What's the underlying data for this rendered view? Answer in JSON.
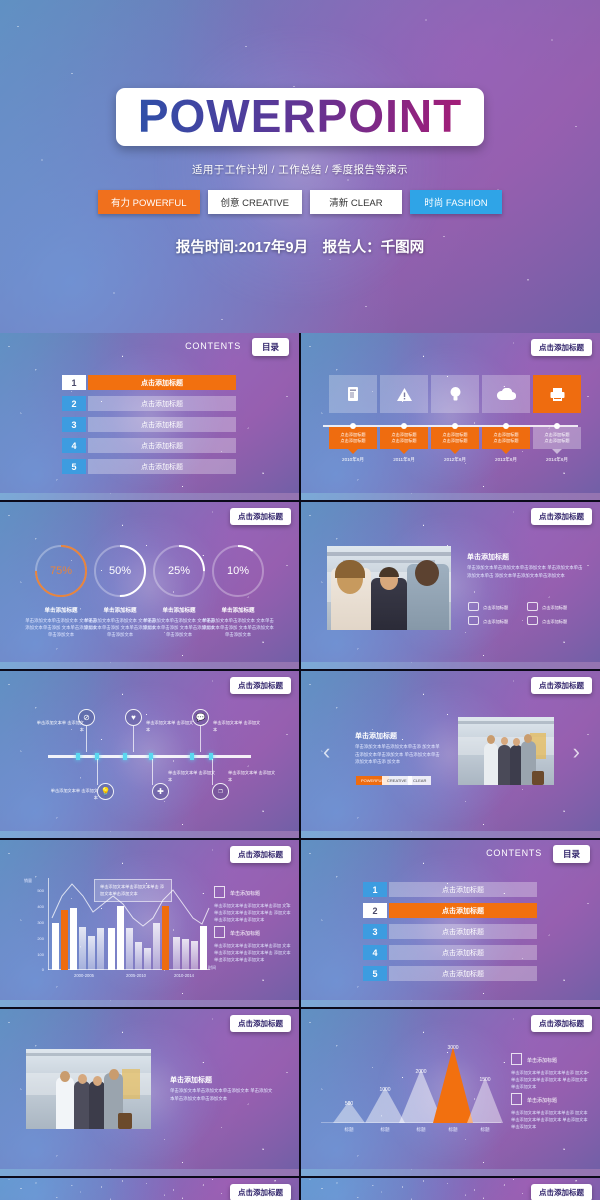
{
  "hero": {
    "title": "POWERPOINT",
    "subtitle": "适用于工作计划 / 工作总结 / 季度报告等演示",
    "tags": [
      {
        "label": "有力 POWERFUL",
        "style": "orange"
      },
      {
        "label": "创意 CREATIVE",
        "style": "white"
      },
      {
        "label": "清新 CLEAR",
        "style": "white"
      },
      {
        "label": "时尚 FASHION",
        "style": "blue"
      }
    ],
    "byline": "报告时间:2017年9月　报告人：千图网"
  },
  "common": {
    "add_title": "点击添加标题",
    "add_text": "单击添加文本",
    "click_add_title": "单击添加标题",
    "contents_label": "CONTENTS",
    "mulu": "目录",
    "body_text": "单击添加文本单击添加文本单击添加文本单击添加文本单击添加文本单击添加文本"
  },
  "colors": {
    "accent_orange": "#f2700f",
    "accent_blue": "#3d9ce0",
    "cyan_tick": "#5ad8f0",
    "plate_white": "#ffffff"
  },
  "slides": [
    {
      "id": "contents-1",
      "type": "contents",
      "contents_label": "CONTENTS",
      "pill": "目录",
      "active_index": 1,
      "rows": [
        {
          "num": "1",
          "label": "点击添加标题"
        },
        {
          "num": "2",
          "label": "点击添加标题"
        },
        {
          "num": "3",
          "label": "点击添加标题"
        },
        {
          "num": "4",
          "label": "点击添加标题"
        },
        {
          "num": "5",
          "label": "点击添加标题"
        }
      ]
    },
    {
      "id": "timeline-cards",
      "type": "timeline-cards",
      "pill": "点击添加标题",
      "active_index": 5,
      "cards": [
        {
          "icon": "document-icon",
          "glyph": "▤",
          "line1": "点击添加标题",
          "line2": "点击添加标题",
          "date": "2010年6月"
        },
        {
          "icon": "warning-icon",
          "glyph": "⚠",
          "line1": "点击添加标题",
          "line2": "点击添加标题",
          "date": "2011年6月"
        },
        {
          "icon": "bulb-icon",
          "glyph": "💡",
          "line1": "点击添加标题",
          "line2": "点击添加标题",
          "date": "2012年6月"
        },
        {
          "icon": "cloud-icon",
          "glyph": "☁",
          "line1": "点击添加标题",
          "line2": "点击添加标题",
          "date": "2013年6月"
        },
        {
          "icon": "printer-icon",
          "glyph": "🖨",
          "line1": "点击添加标题",
          "line2": "点击添加标题",
          "date": "2014年6月"
        }
      ]
    },
    {
      "id": "donut-stats",
      "type": "donut",
      "pill": "点击添加标题",
      "items": [
        {
          "value": "75%",
          "pct": 75,
          "accent": true,
          "caption": "单击添加标题",
          "desc": "单击添加文本单击添加文本 文本单击添加文本单击添加 文本单击添加文本 单击添加文本"
        },
        {
          "value": "50%",
          "pct": 50,
          "accent": false,
          "caption": "单击添加标题",
          "desc": "单击添加文本单击添加文本 文本单击添加文本单击添加 文本单击添加文本 单击添加文本"
        },
        {
          "value": "25%",
          "pct": 25,
          "accent": false,
          "caption": "单击添加标题",
          "desc": "单击添加文本单击添加文本 文本单击添加文本单击添加 文本单击添加文本 单击添加文本"
        },
        {
          "value": "10%",
          "pct": 10,
          "accent": false,
          "caption": "单击添加标题",
          "desc": "单击添加文本单击添加文本 文本单击添加文本单击添加 文本单击添加文本 单击添加文本"
        }
      ]
    },
    {
      "id": "photo-left-text-right",
      "type": "photo-text",
      "pill": "点击添加标题",
      "heading": "单击添加标题",
      "body": "单击添加文本单击添加文本单击添加文本 单击添加文本单击添加文本单击 添加文本单击添加文本单击添加文本",
      "icons": [
        {
          "icon": "monitor-icon",
          "label": "点击添加标题"
        },
        {
          "icon": "tv-icon",
          "label": "点击添加标题"
        },
        {
          "icon": "laptop-icon",
          "label": "点击添加标题"
        },
        {
          "icon": "calculator-icon",
          "label": "点击添加标题"
        }
      ]
    },
    {
      "id": "icon-timeline",
      "type": "icon-timeline",
      "pill": "点击添加标题",
      "nodes": [
        {
          "icon": "no-entry-icon",
          "glyph": "⊘",
          "text": "单击添加文本单 击添加文本",
          "above": true
        },
        {
          "icon": "bulb-icon",
          "glyph": "💡",
          "text": "单击添加文本单 击添加文本",
          "above": false
        },
        {
          "icon": "heart-icon",
          "glyph": "♥",
          "text": "单击添加文本单 击添加文本",
          "above": true
        },
        {
          "icon": "plus-icon",
          "glyph": "✚",
          "text": "单击添加文本单 击添加文本",
          "above": false
        },
        {
          "icon": "chat-icon",
          "glyph": "💬",
          "text": "单击添加文本单 击添加文本",
          "above": true
        },
        {
          "icon": "tag-icon",
          "glyph": "❐",
          "text": "单击添加文本单 击添加文本",
          "above": false
        }
      ]
    },
    {
      "id": "carousel-photo",
      "type": "carousel",
      "pill": "点击添加标题",
      "heading": "单击添加标题",
      "body": "单击添加文本单击添加文本单击添 加文本单击添加文本单击添加文本 单击添加文本单击添加文本单击添 加文本",
      "tags": [
        {
          "label": "POWERFUL",
          "style": "orange"
        },
        {
          "label": "CREATIVE",
          "style": "white"
        },
        {
          "label": "CLEAR",
          "style": "white"
        }
      ],
      "prev": "‹",
      "next": "›"
    },
    {
      "id": "bar-chart-slide",
      "type": "bar-chart",
      "pill": "点击添加标题",
      "callout": "单击添加文本单击添加文本单击 添加文本单击添加文本",
      "legend": [
        {
          "icon": "calendar-icon",
          "title": "单击添加标题",
          "desc": "单击添加文本单击添加文本单击添加 文本单击添加文本单击添加文本单击 添加文本单击添加文本单击添加文本"
        },
        {
          "icon": "chart-icon",
          "title": "单击添加标题",
          "desc": "单击添加文本单击添加文本单击添加 文本单击添加文本单击添加文本单击 添加文本单击添加文本单击添加文本"
        }
      ]
    },
    {
      "id": "contents-2",
      "type": "contents",
      "contents_label": "CONTENTS",
      "pill": "目录",
      "active_index": 2,
      "rows": [
        {
          "num": "1",
          "label": "点击添加标题"
        },
        {
          "num": "2",
          "label": "点击添加标题"
        },
        {
          "num": "3",
          "label": "点击添加标题"
        },
        {
          "num": "4",
          "label": "点击添加标题"
        },
        {
          "num": "5",
          "label": "点击添加标题"
        }
      ]
    },
    {
      "id": "photo-left-text-right-2",
      "type": "photo-text2",
      "pill": "点击添加标题",
      "heading": "单击添加标题",
      "body": "单击添加文本单击添加文本单击添加文本 单击添加文本单击添加文本单击添加文本"
    },
    {
      "id": "triangle-chart-slide",
      "type": "triangle-chart",
      "pill": "点击添加标题",
      "legend": [
        {
          "icon": "calendar-icon",
          "title": "单击添加标题",
          "desc": "单击添加文本单击添加文本单击添 加文本单击添加文本单击添加文本 单击添加文本单击添加文本"
        },
        {
          "icon": "person-icon",
          "title": "单击添加标题",
          "desc": "单击添加文本单击添加文本单击添 加文本单击添加文本单击添加文本 单击添加文本单击添加文本"
        }
      ]
    },
    {
      "id": "partial-left",
      "type": "partial",
      "pill": "点击添加标题"
    },
    {
      "id": "partial-right",
      "type": "partial",
      "pill": "点击添加标题"
    }
  ],
  "chart_data": [
    {
      "type": "bar",
      "title": "",
      "xlabel": "时间",
      "ylabel": "销量",
      "ylim": [
        0,
        550
      ],
      "yticks": [
        0,
        100,
        200,
        300,
        400,
        500
      ],
      "categories": [
        "2000-2005",
        "2005-2010",
        "2010-2014"
      ],
      "bars": [
        260,
        330,
        340,
        235,
        190,
        230,
        230,
        350,
        230,
        155,
        120,
        260,
        350,
        180,
        170,
        160,
        240
      ],
      "highlight_indices": [
        1,
        12
      ],
      "line_series": [
        {
          "name": "trend-1",
          "values": [
            300,
            430,
            500,
            430,
            330,
            390,
            430,
            380,
            300,
            260,
            330,
            420,
            470,
            400,
            330,
            300,
            360
          ]
        }
      ]
    },
    {
      "type": "bar",
      "title": "",
      "categories": [
        "标题",
        "标题",
        "标题",
        "标题",
        "标题"
      ],
      "values": [
        500,
        1000,
        2000,
        3000,
        1500
      ],
      "labels": [
        "500",
        "1000",
        "2000",
        "3000",
        "1500"
      ],
      "highlight_index": 3,
      "xlabel": "",
      "ylabel": "",
      "ylim": [
        0,
        3000
      ]
    }
  ]
}
